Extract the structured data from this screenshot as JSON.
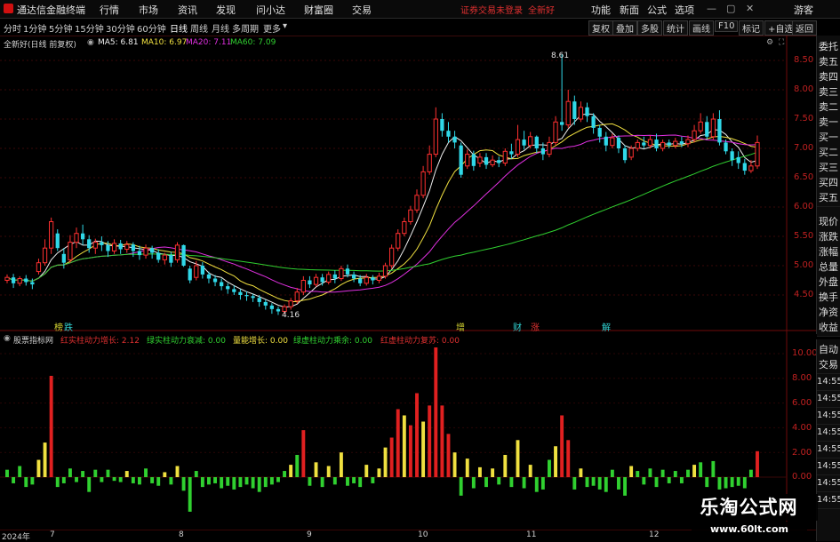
{
  "app": {
    "title": "通达信金融终端",
    "menu": [
      "行情",
      "市场",
      "资讯",
      "发现",
      "问小达",
      "财富圈",
      "交易"
    ],
    "notice": "证券交易未登录",
    "stock_name": "全新好",
    "right_menu": [
      "功能",
      "新面",
      "公式",
      "选项"
    ],
    "user": "游客"
  },
  "periods": {
    "items": [
      "分时",
      "1分钟",
      "5分钟",
      "15分钟",
      "30分钟",
      "60分钟",
      "日线",
      "周线",
      "月线",
      "多周期",
      "更多"
    ],
    "active": "日线",
    "right_buttons": [
      "复权",
      "叠加",
      "多股",
      "统计",
      "画线",
      "F10",
      "标记",
      "+自选",
      "返回"
    ]
  },
  "main_legend": {
    "title": "全新好(日线 前复权)",
    "ma": [
      {
        "label": "MA5: 6.81",
        "color": "#f0f0f0"
      },
      {
        "label": "MA10: 6.97",
        "color": "#f0e040"
      },
      {
        "label": "MA20: 7.11",
        "color": "#e030e0"
      },
      {
        "label": "MA60: 7.09",
        "color": "#30d030"
      }
    ]
  },
  "price_axis": [
    "8.50",
    "8.00",
    "7.50",
    "7.00",
    "6.50",
    "6.00",
    "5.50",
    "5.00",
    "4.50"
  ],
  "annotations": {
    "high": "8.61",
    "low": "4.16"
  },
  "events": [
    {
      "label": "榜",
      "color": "#d0d030"
    },
    {
      "label": "跌",
      "color": "#30d0d0"
    },
    {
      "label": "增",
      "color": "#d0d030"
    },
    {
      "label": "财",
      "color": "#30d0d0"
    },
    {
      "label": "涨",
      "color": "#e03030"
    },
    {
      "label": "解",
      "color": "#30d0d0"
    }
  ],
  "indicator_legend": {
    "title": "股票指标网",
    "items": [
      {
        "label": "红实柱动力增长: 2.12",
        "color": "#e03030"
      },
      {
        "label": "绿实柱动力衰减: 0.00",
        "color": "#30d030"
      },
      {
        "label": "量能增长: 0.00",
        "color": "#f0e040"
      },
      {
        "label": "绿虚柱动力乘余: 0.00",
        "color": "#30d030"
      },
      {
        "label": "红虚柱动力复苏: 0.00",
        "color": "#e03030"
      }
    ]
  },
  "indicator_axis": [
    "10.00",
    "8.00",
    "6.00",
    "4.00",
    "2.00",
    "0.00"
  ],
  "side_panel": [
    "委托",
    "卖五",
    "卖四",
    "卖三",
    "卖二",
    "卖一",
    "买一",
    "买二",
    "买三",
    "买四",
    "买五",
    "现价",
    "涨跌",
    "涨幅",
    "总量",
    "外盘",
    "换手",
    "净资",
    "收益"
  ],
  "side_panel2": [
    "自动",
    "交易",
    "14:55",
    "14:55",
    "14:55",
    "14:55",
    "14:55",
    "14:55",
    "14:55",
    "14:55"
  ],
  "x_axis": [
    "2024年",
    "7",
    "8",
    "9",
    "10",
    "11",
    "12"
  ],
  "watermark": {
    "line1": "乐淘公式网",
    "line2": "www.60lt.com"
  },
  "chart_data": {
    "type": "candlestick",
    "ylim": [
      4.1,
      8.75
    ],
    "candles": [
      [
        4.75,
        4.8,
        4.7,
        4.85
      ],
      [
        4.8,
        4.7,
        4.62,
        4.86
      ],
      [
        4.7,
        4.78,
        4.65,
        4.82
      ],
      [
        4.78,
        4.72,
        4.66,
        4.84
      ],
      [
        4.72,
        4.68,
        4.6,
        4.78
      ],
      [
        4.9,
        5.05,
        4.85,
        5.12
      ],
      [
        5.05,
        5.3,
        5.0,
        5.45
      ],
      [
        5.3,
        5.75,
        5.2,
        5.82
      ],
      [
        5.55,
        5.3,
        5.25,
        5.62
      ],
      [
        5.2,
        5.05,
        4.95,
        5.3
      ],
      [
        5.1,
        5.4,
        5.05,
        5.52
      ],
      [
        5.4,
        5.55,
        5.3,
        5.65
      ],
      [
        5.55,
        5.45,
        5.35,
        5.7
      ],
      [
        5.45,
        5.3,
        5.22,
        5.52
      ],
      [
        5.3,
        5.4,
        5.2,
        5.46
      ],
      [
        5.4,
        5.35,
        5.25,
        5.5
      ],
      [
        5.35,
        5.25,
        5.15,
        5.42
      ],
      [
        5.25,
        5.38,
        5.2,
        5.45
      ],
      [
        5.38,
        5.28,
        5.2,
        5.44
      ],
      [
        5.28,
        5.36,
        5.22,
        5.42
      ],
      [
        5.36,
        5.25,
        5.15,
        5.4
      ],
      [
        5.25,
        5.18,
        5.1,
        5.34
      ],
      [
        5.18,
        5.3,
        5.12,
        5.36
      ],
      [
        5.3,
        5.22,
        5.12,
        5.34
      ],
      [
        5.22,
        5.1,
        5.05,
        5.28
      ],
      [
        5.1,
        5.18,
        5.02,
        5.22
      ],
      [
        5.18,
        5.05,
        4.98,
        5.24
      ],
      [
        5.1,
        5.35,
        5.05,
        5.4
      ],
      [
        5.35,
        5.0,
        4.98,
        5.36
      ],
      [
        4.95,
        4.75,
        4.7,
        5.0
      ],
      [
        4.8,
        5.0,
        4.75,
        5.08
      ],
      [
        5.0,
        4.85,
        4.78,
        5.06
      ],
      [
        4.85,
        4.78,
        4.7,
        4.9
      ],
      [
        4.78,
        4.72,
        4.65,
        4.84
      ],
      [
        4.72,
        4.65,
        4.58,
        4.78
      ],
      [
        4.65,
        4.6,
        4.52,
        4.7
      ],
      [
        4.6,
        4.55,
        4.5,
        4.66
      ],
      [
        4.55,
        4.5,
        4.42,
        4.6
      ],
      [
        4.5,
        4.48,
        4.4,
        4.56
      ],
      [
        4.48,
        4.45,
        4.38,
        4.52
      ],
      [
        4.45,
        4.38,
        4.3,
        4.5
      ],
      [
        4.38,
        4.32,
        4.25,
        4.42
      ],
      [
        4.32,
        4.26,
        4.18,
        4.36
      ],
      [
        4.26,
        4.22,
        4.16,
        4.3
      ],
      [
        4.22,
        4.3,
        4.18,
        4.34
      ],
      [
        4.3,
        4.4,
        4.25,
        4.45
      ],
      [
        4.4,
        4.55,
        4.35,
        4.62
      ],
      [
        4.55,
        4.75,
        4.5,
        4.82
      ],
      [
        4.75,
        4.68,
        4.62,
        4.82
      ],
      [
        4.68,
        4.8,
        4.64,
        4.86
      ],
      [
        4.8,
        4.72,
        4.66,
        4.86
      ],
      [
        4.72,
        4.85,
        4.68,
        4.9
      ],
      [
        4.85,
        4.78,
        4.7,
        4.92
      ],
      [
        4.78,
        4.95,
        4.74,
        5.0
      ],
      [
        4.95,
        4.85,
        4.8,
        5.02
      ],
      [
        4.85,
        4.78,
        4.72,
        4.9
      ],
      [
        4.78,
        4.7,
        4.65,
        4.84
      ],
      [
        4.7,
        4.8,
        4.66,
        4.86
      ],
      [
        4.8,
        4.75,
        4.68,
        4.84
      ],
      [
        4.75,
        4.82,
        4.7,
        4.88
      ],
      [
        4.82,
        5.0,
        4.78,
        5.05
      ],
      [
        5.0,
        5.3,
        4.95,
        5.36
      ],
      [
        5.3,
        5.55,
        5.25,
        5.62
      ],
      [
        5.55,
        5.75,
        5.5,
        5.82
      ],
      [
        5.75,
        5.95,
        5.7,
        6.02
      ],
      [
        5.95,
        6.2,
        5.9,
        6.3
      ],
      [
        6.2,
        6.6,
        6.15,
        6.7
      ],
      [
        6.6,
        6.9,
        6.55,
        7.05
      ],
      [
        6.9,
        7.5,
        6.85,
        7.7
      ],
      [
        7.5,
        7.3,
        7.2,
        7.6
      ],
      [
        7.3,
        7.2,
        7.1,
        7.45
      ],
      [
        7.2,
        7.1,
        7.0,
        7.3
      ],
      [
        7.05,
        6.55,
        6.5,
        7.1
      ],
      [
        6.7,
        6.9,
        6.65,
        6.98
      ],
      [
        6.9,
        6.7,
        6.62,
        6.96
      ],
      [
        6.75,
        6.85,
        6.68,
        6.92
      ],
      [
        6.85,
        6.72,
        6.65,
        6.92
      ],
      [
        6.72,
        6.8,
        6.68,
        6.88
      ],
      [
        6.8,
        6.75,
        6.68,
        6.86
      ],
      [
        6.75,
        6.95,
        6.7,
        7.0
      ],
      [
        6.95,
        6.9,
        6.82,
        7.08
      ],
      [
        6.9,
        7.15,
        6.85,
        7.4
      ],
      [
        7.15,
        7.05,
        6.98,
        7.3
      ],
      [
        7.05,
        7.2,
        7.0,
        7.28
      ],
      [
        7.2,
        7.0,
        6.92,
        7.22
      ],
      [
        7.0,
        6.9,
        6.8,
        7.1
      ],
      [
        6.9,
        7.1,
        6.85,
        7.2
      ],
      [
        7.1,
        7.45,
        7.05,
        7.55
      ],
      [
        7.45,
        7.4,
        7.3,
        8.61
      ],
      [
        7.4,
        7.8,
        7.35,
        8.0
      ],
      [
        7.8,
        7.5,
        7.4,
        7.9
      ],
      [
        7.5,
        7.7,
        7.45,
        7.8
      ],
      [
        7.7,
        7.55,
        7.45,
        7.78
      ],
      [
        7.55,
        7.35,
        7.25,
        7.6
      ],
      [
        7.35,
        7.2,
        7.1,
        7.4
      ],
      [
        7.2,
        7.05,
        6.95,
        7.28
      ],
      [
        7.05,
        7.18,
        7.0,
        7.25
      ],
      [
        7.18,
        7.0,
        6.92,
        7.22
      ],
      [
        7.0,
        6.8,
        6.75,
        7.05
      ],
      [
        6.85,
        7.0,
        6.8,
        7.05
      ],
      [
        7.0,
        7.1,
        6.95,
        7.15
      ],
      [
        7.1,
        7.05,
        7.0,
        7.2
      ],
      [
        7.05,
        7.15,
        7.0,
        7.22
      ],
      [
        7.15,
        7.0,
        6.95,
        7.25
      ],
      [
        7.0,
        7.1,
        6.95,
        7.15
      ],
      [
        7.1,
        7.05,
        7.0,
        7.15
      ],
      [
        7.05,
        7.12,
        7.0,
        7.18
      ],
      [
        7.12,
        7.08,
        7.02,
        7.2
      ],
      [
        7.08,
        7.15,
        7.02,
        7.22
      ],
      [
        7.15,
        7.3,
        7.1,
        7.4
      ],
      [
        7.3,
        7.45,
        7.25,
        7.6
      ],
      [
        7.45,
        7.2,
        7.15,
        7.55
      ],
      [
        7.2,
        7.5,
        7.15,
        7.6
      ],
      [
        7.5,
        7.1,
        7.05,
        7.65
      ],
      [
        7.1,
        6.95,
        6.9,
        7.15
      ],
      [
        6.95,
        6.8,
        6.7,
        7.0
      ],
      [
        6.85,
        6.75,
        6.65,
        6.95
      ],
      [
        6.75,
        6.62,
        6.55,
        6.82
      ],
      [
        6.62,
        6.7,
        6.58,
        6.8
      ],
      [
        6.7,
        7.1,
        6.65,
        7.22
      ]
    ],
    "histogram": [
      0.6,
      -0.5,
      0.9,
      -0.8,
      -0.6,
      1.4,
      2.8,
      8.2,
      -0.8,
      -0.5,
      0.7,
      -0.4,
      0.5,
      -1.2,
      0.6,
      -0.4,
      0.6,
      -0.3,
      -0.4,
      0.5,
      -0.5,
      -0.6,
      0.7,
      -0.5,
      -0.7,
      0.4,
      -0.6,
      0.9,
      -1.1,
      -2.8,
      0.5,
      -0.8,
      -0.6,
      -0.5,
      -0.9,
      -0.7,
      -1.0,
      -0.8,
      -0.6,
      -0.9,
      -1.2,
      -0.8,
      -0.6,
      -0.4,
      0.5,
      1.0,
      1.8,
      3.8,
      -0.7,
      1.2,
      -0.8,
      0.9,
      -0.6,
      2.0,
      -0.7,
      -0.5,
      -0.8,
      1.0,
      -0.5,
      0.7,
      2.4,
      3.2,
      5.5,
      5.0,
      4.2,
      6.8,
      4.5,
      5.8,
      10.5,
      5.8,
      3.5,
      2.0,
      -1.5,
      1.5,
      -0.9,
      0.8,
      -0.8,
      0.7,
      -0.6,
      1.8,
      -0.8,
      3.0,
      -0.9,
      1.0,
      -1.2,
      -1.0,
      1.4,
      2.5,
      5.0,
      3.0,
      -1.0,
      0.7,
      -0.8,
      -0.7,
      -1.0,
      -1.2,
      0.6,
      -1.0,
      -1.5,
      0.9,
      0.5,
      -0.6,
      0.7,
      -0.8,
      0.6,
      -0.5,
      0.5,
      -0.5,
      0.6,
      1.0,
      1.2,
      -0.8,
      1.3,
      -1.0,
      -0.9,
      -0.8,
      -0.7,
      -0.9,
      0.6,
      2.1
    ],
    "hist_ylim": [
      -3.0,
      11.0
    ]
  }
}
